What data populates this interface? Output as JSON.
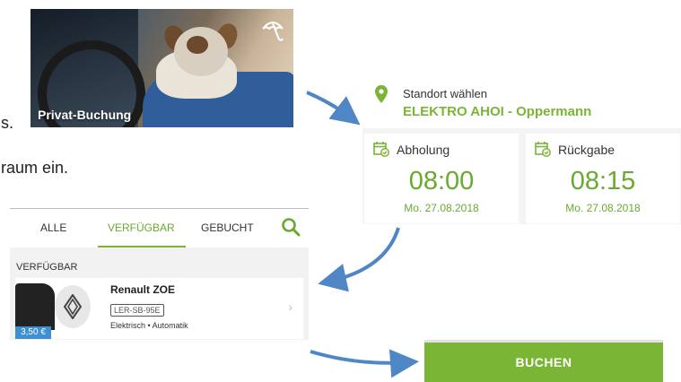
{
  "fragments": {
    "line1": "s.",
    "line2": "raum ein."
  },
  "photo": {
    "label": "Privat-Buchung",
    "icon": "umbrella-icon"
  },
  "location": {
    "label": "Standort wählen",
    "value": "ELEKTRO AHOI - Oppermann",
    "icon": "map-pin-icon"
  },
  "pickup": {
    "label": "Abholung",
    "time": "08:00",
    "date": "Mo. 27.08.2018",
    "icon": "calendar-check-icon"
  },
  "return": {
    "label": "Rückgabe",
    "time": "08:15",
    "date": "Mo. 27.08.2018",
    "icon": "calendar-check-icon"
  },
  "tabs": [
    {
      "label": "ALLE",
      "active": false
    },
    {
      "label": "VERFÜGBAR",
      "active": true
    },
    {
      "label": "GEBUCHT",
      "active": false
    }
  ],
  "list": {
    "section": "VERFÜGBAR",
    "items": [
      {
        "name": "Renault ZOE",
        "plate": "LER-SB-95E",
        "desc": "Elektrisch • Automatik",
        "price": "3,50 €"
      }
    ]
  },
  "book_button": {
    "label": "BUCHEN"
  },
  "colors": {
    "accent": "#7ab536",
    "accent_text": "#6aa92f",
    "arrow": "#4f86c6",
    "price_badge": "#3d8fd1"
  }
}
